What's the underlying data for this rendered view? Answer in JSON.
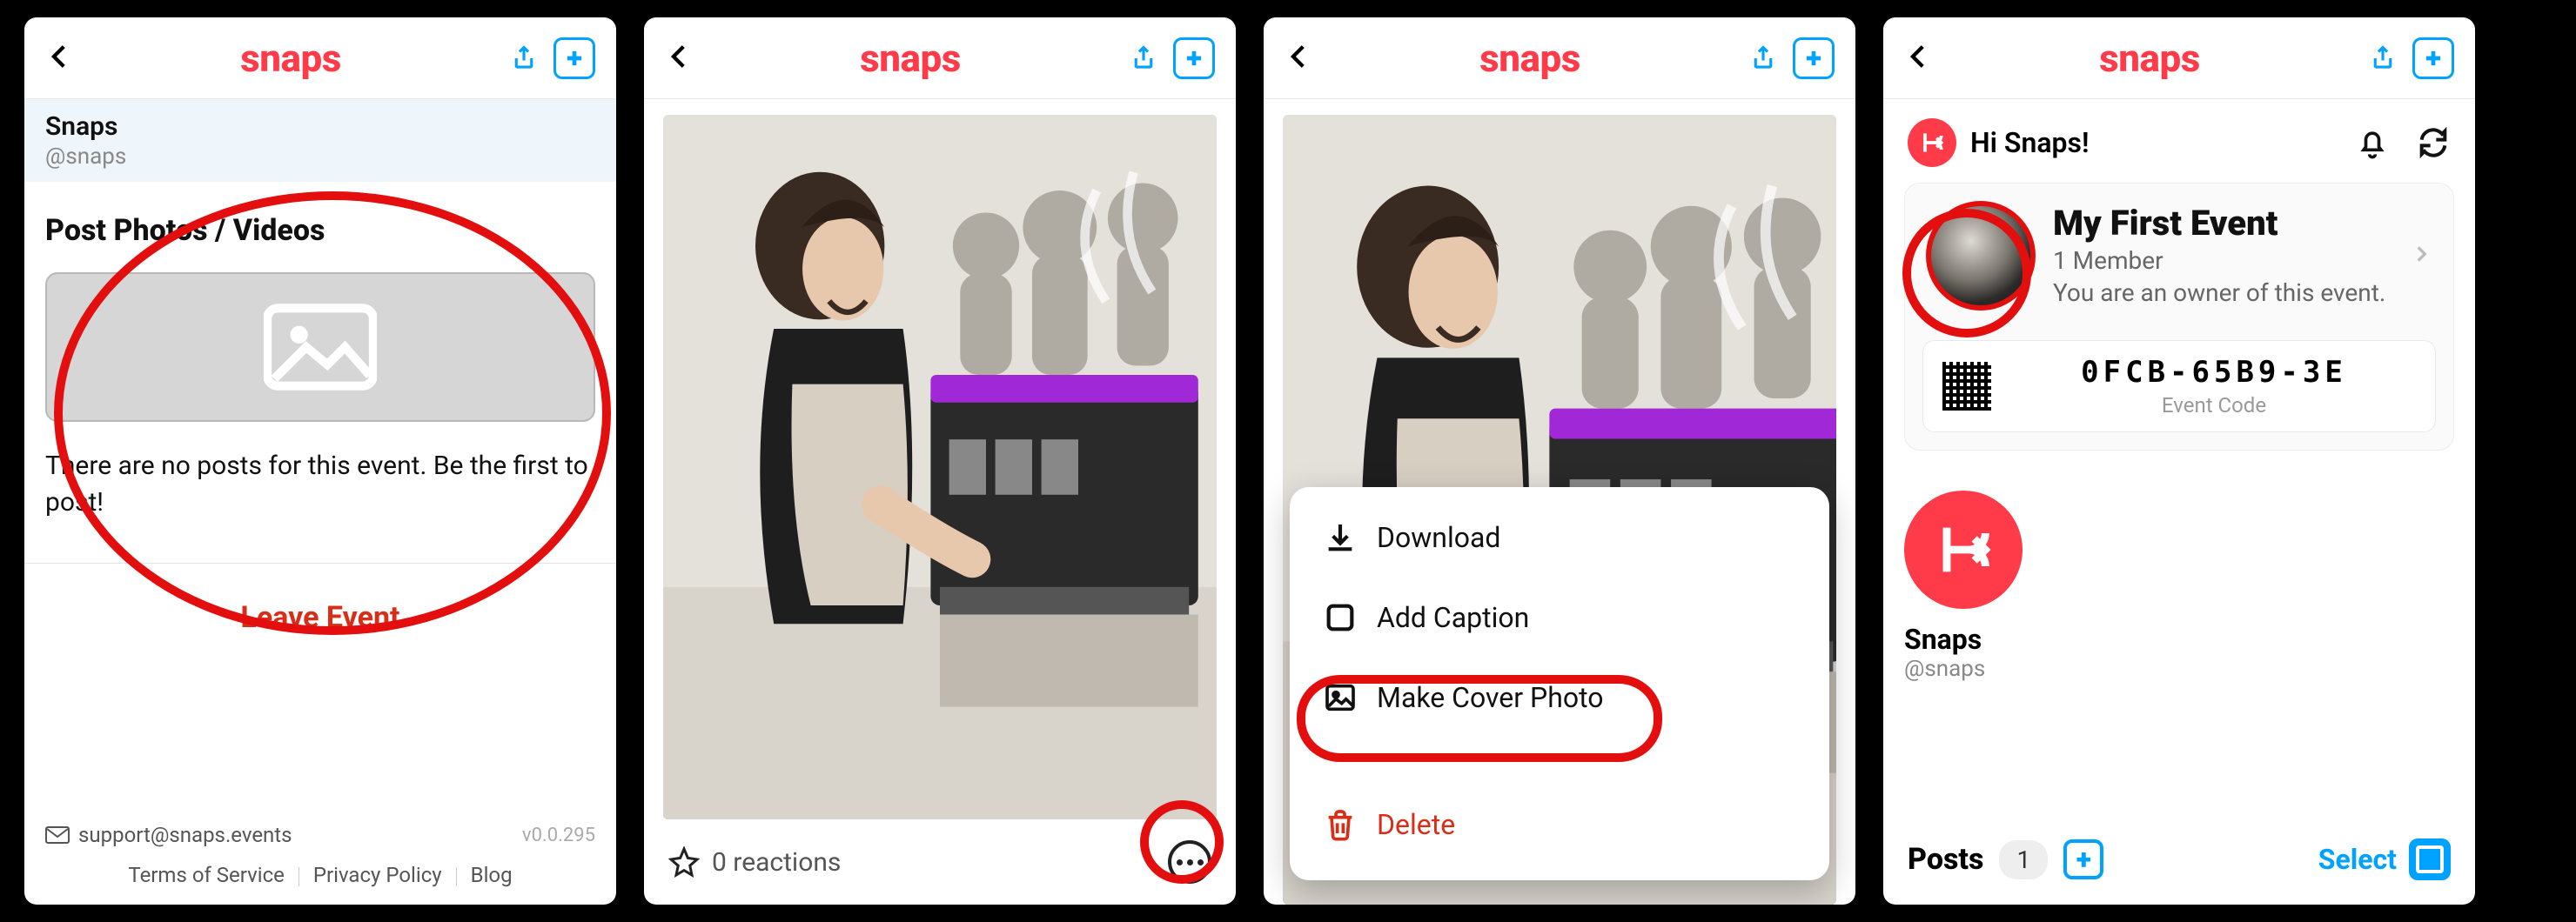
{
  "brand": "snaps",
  "colors": {
    "accent": "#ff3b4a",
    "action": "#00a2ff",
    "danger": "#d82e18",
    "annotation": "#e30e0e"
  },
  "screen1": {
    "account_name": "Snaps",
    "account_handle": "@snaps",
    "post_heading": "Post Photos / Videos",
    "empty_message": "There are no posts for this event. Be the first to post!",
    "leave_label": "Leave Event",
    "support_email": "support@snaps.events",
    "version": "v0.0.295",
    "links": [
      "Terms of Service",
      "Privacy Policy",
      "Blog"
    ]
  },
  "screen2": {
    "reactions_label": "0 reactions"
  },
  "screen3": {
    "menu": {
      "download": "Download",
      "caption": "Add Caption",
      "cover": "Make Cover Photo",
      "delete": "Delete"
    }
  },
  "screen4": {
    "greeting": "Hi Snaps!",
    "event_title": "My First Event",
    "member_line": "1 Member",
    "owner_line": "You are an owner of this event.",
    "event_code": "0FCB-65B9-3E",
    "event_code_label": "Event Code",
    "snaps_name": "Snaps",
    "snaps_handle": "@snaps",
    "posts_label": "Posts",
    "posts_count": "1",
    "select_label": "Select"
  }
}
